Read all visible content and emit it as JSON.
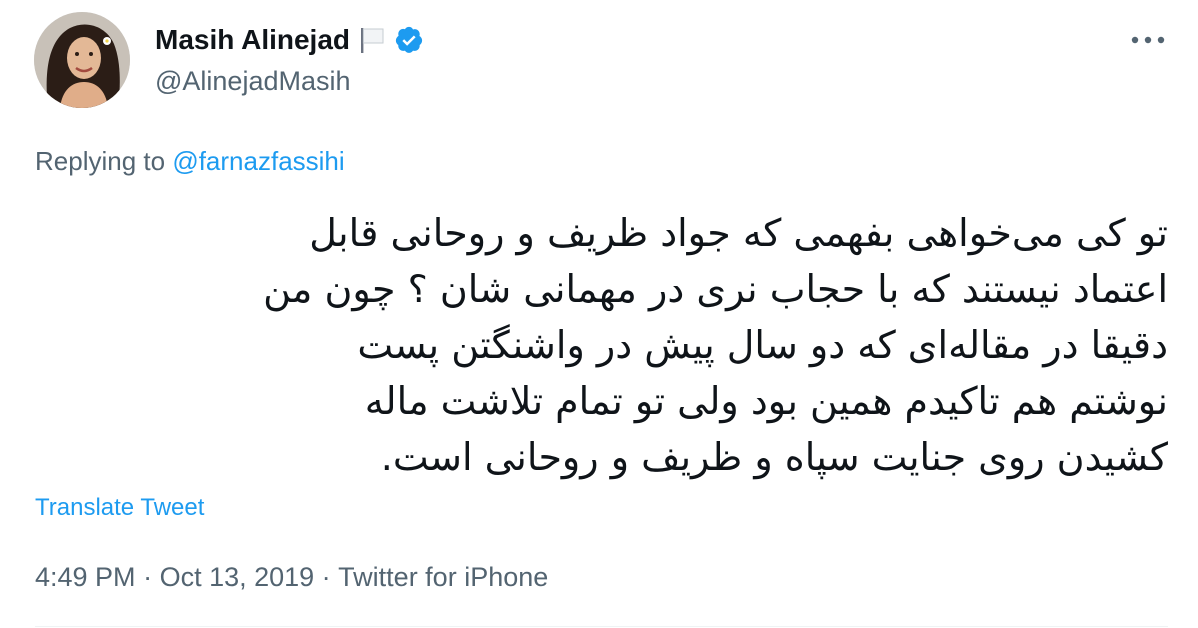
{
  "author": {
    "display_name": "Masih Alinejad",
    "handle": "@AlinejadMasih",
    "flag_icon": "white-flag-icon",
    "verified_icon": "verified-badge-icon",
    "verified_color": "#1d9bf0",
    "avatar_icon": "profile-photo"
  },
  "more_icon": "more-dots-icon",
  "reply": {
    "prefix": "Replying to ",
    "mention": "@farnazfassihi"
  },
  "tweet": {
    "lines": [
      "تو کی می‌خواهی بفهمی که جواد ظریف و روحانی قابل",
      "اعتماد نیستند که با حجاب نری در مهمانی شان ؟ چون من",
      "دقیقا در  مقاله‌ای که دو سال پیش در واشنگتن پست",
      "نوشتم هم تاکیدم همین بود  ولی تو تمام تلاشت ماله",
      "کشیدن روی جنایت سپاه و ظریف و روحانی است."
    ]
  },
  "translate_label": "Translate Tweet",
  "meta": {
    "time": "4:49 PM",
    "sep1": " · ",
    "date": "Oct 13, 2019",
    "sep2": " · ",
    "source": "Twitter for iPhone"
  },
  "colors": {
    "accent": "#1d9bf0",
    "secondary_text": "#536471",
    "primary_text": "#0f1419"
  }
}
